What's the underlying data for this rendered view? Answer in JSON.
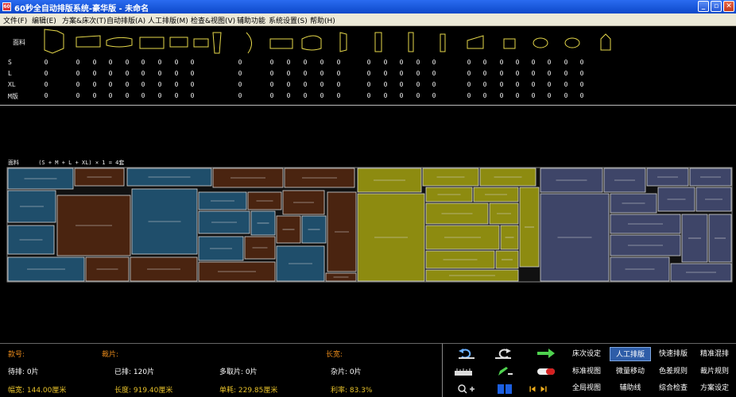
{
  "window": {
    "title": "60秒全自动排版系统-豪华版 - 未命名",
    "app_icon": "app-logo-icon"
  },
  "menu": [
    "文件(F)",
    "编辑(E)",
    "方案&床次(T)",
    "自动排版(A)",
    "人工排版(M)",
    "检查&视图(V)",
    "辅助功能",
    "系统设置(S)",
    "帮助(H)"
  ],
  "pieces": {
    "label": "面料",
    "rows": [
      {
        "size": "S",
        "counts": [
          "0",
          "0",
          "0",
          "0",
          "0",
          "0",
          "0",
          "0",
          "0",
          "0",
          "0",
          "0",
          "0",
          "0",
          "0",
          "0",
          "0",
          "0",
          "0",
          "0",
          "0",
          "0",
          "0",
          "0",
          "0",
          "0",
          "0",
          "0",
          "0",
          "0",
          "0",
          "0",
          "0",
          "0",
          "0",
          "0",
          "0",
          "0",
          "0",
          "0",
          "0",
          "0",
          "0",
          "0",
          "0",
          "0"
        ]
      },
      {
        "size": "L",
        "counts": [
          "0",
          "0",
          "0",
          "0",
          "0",
          "0",
          "0",
          "0",
          "0",
          "0",
          "0",
          "0",
          "0",
          "0",
          "0",
          "0",
          "0",
          "0",
          "0",
          "0",
          "0",
          "0",
          "0",
          "0",
          "0",
          "0",
          "0",
          "0",
          "0",
          "0",
          "0",
          "0",
          "0",
          "0",
          "0",
          "0",
          "0",
          "0",
          "0",
          "0",
          "0",
          "0",
          "0",
          "0",
          "0",
          "0"
        ]
      },
      {
        "size": "XL",
        "counts": [
          "0",
          "0",
          "0",
          "0",
          "0",
          "0",
          "0",
          "0",
          "0",
          "0",
          "0",
          "0",
          "0",
          "0",
          "0",
          "0",
          "0",
          "0",
          "0",
          "0",
          "0",
          "0",
          "0",
          "0",
          "0",
          "0",
          "0",
          "0",
          "0",
          "0",
          "0",
          "0",
          "0",
          "0",
          "0",
          "0",
          "0",
          "0",
          "0",
          "0",
          "0",
          "0",
          "0",
          "0",
          "0",
          "0"
        ]
      },
      {
        "size": "M版",
        "counts": [
          "0",
          "0",
          "0",
          "0",
          "0",
          "0",
          "0",
          "0",
          "0",
          "0",
          "0",
          "0",
          "0",
          "0",
          "0",
          "0",
          "0",
          "0",
          "0",
          "0",
          "0",
          "0",
          "0",
          "0",
          "0",
          "0",
          "0",
          "0",
          "0",
          "0",
          "0",
          "0",
          "0",
          "0",
          "0",
          "0",
          "0",
          "0",
          "0",
          "0",
          "0",
          "0",
          "0",
          "0",
          "0",
          "0"
        ]
      }
    ]
  },
  "layout": {
    "label": "面料",
    "formula": "(S + M + L + XL) × 1 = 4套",
    "colors": {
      "blue": "#1f4e6b",
      "brown": "#4a2410",
      "olive": "#8d8b10",
      "slate": "#3e4568"
    }
  },
  "status": {
    "style_label": "款号:",
    "pieces_label": "裁片:",
    "length_label": "长宽:",
    "pending": "待排: 0片",
    "placed": "已排: 120片",
    "multi_fold": "多取片: 0片",
    "misc": "杂片: 0片",
    "width": "幅宽: 144.00厘米",
    "length": "长度: 919.40厘米",
    "unit_usage": "单耗: 229.85厘米",
    "utilization": "利率: 83.3%"
  },
  "tools": {
    "row1": [
      "床次设定",
      "人工排版",
      "快速排版",
      "精准混排"
    ],
    "row2": [
      "标准视图",
      "微量移动",
      "色差规则",
      "裁片规则"
    ],
    "row3": [
      "全局视图",
      "辅助线",
      "综合检查",
      "方案设定"
    ],
    "icons": [
      "undo-icon",
      "redo-icon",
      "arrow-right-icon",
      "ruler-icon",
      "pencil-icon",
      "pill-toggle-icon",
      "zoom-icon",
      "book-icon",
      "first-last-icon"
    ]
  }
}
